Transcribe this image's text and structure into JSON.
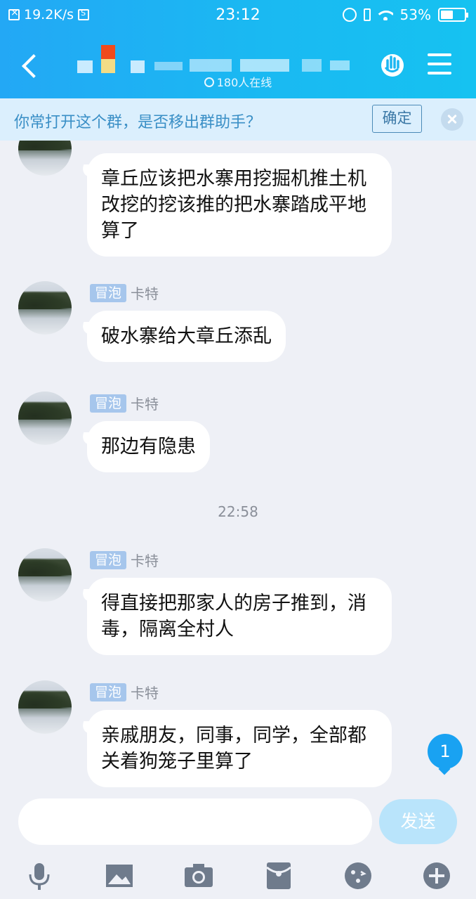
{
  "status_bar": {
    "net_speed": "19.2K/s",
    "time": "23:12",
    "battery": "53%",
    "battery_level": 0.53,
    "icons": [
      "x-notification-icon",
      "s-app-icon",
      "alarm-icon",
      "vibrate-icon",
      "wifi-icon",
      "battery-icon"
    ]
  },
  "header": {
    "online_count": "180人在线",
    "icons": [
      "back-icon",
      "hand-gesture-icon",
      "menu-icon"
    ]
  },
  "notice": {
    "text": "你常打开这个群，是否移出群助手？",
    "confirm_label": "确定"
  },
  "messages": [
    {
      "badge": "",
      "nick": "",
      "text": "章丘应该把水寨用挖掘机推土机改挖的挖该推的把水寨踏成平地算了"
    },
    {
      "badge": "冒泡",
      "nick": "卡特",
      "text": "破水寨给大章丘添乱"
    },
    {
      "badge": "冒泡",
      "nick": "卡特",
      "text": "那边有隐患"
    },
    {
      "badge": "冒泡",
      "nick": "卡特",
      "text": "得直接把那家人的房子推到，消毒，隔离全村人"
    },
    {
      "badge": "冒泡",
      "nick": "卡特",
      "text": "亲戚朋友，同事，同学，全部都关着狗笼子里算了"
    }
  ],
  "timestamp": "22:58",
  "unread_count": "1",
  "input": {
    "value": "",
    "send_label": "发送"
  },
  "toolbar": [
    "microphone-icon",
    "image-icon",
    "camera-icon",
    "red-packet-icon",
    "emoji-icon",
    "plus-icon"
  ],
  "colors": {
    "header": "#1eb2f3",
    "accent": "#19a2f2",
    "badge": "#a6c6ec"
  }
}
